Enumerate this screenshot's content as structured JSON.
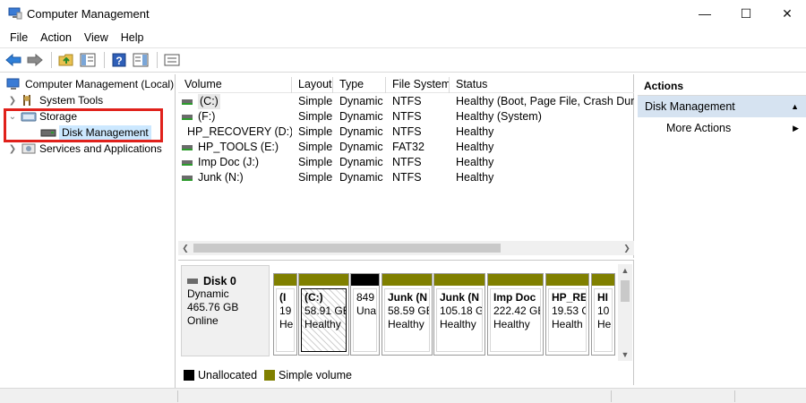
{
  "window": {
    "title": "Computer Management",
    "min_glyph": "—",
    "max_glyph": "☐",
    "close_glyph": "✕"
  },
  "menu": [
    "File",
    "Action",
    "View",
    "Help"
  ],
  "toolbar": {
    "icons": [
      "back-arrow-icon",
      "forward-arrow-icon",
      "up-folder-icon",
      "show-hide-console-tree-icon",
      "help-icon",
      "show-hide-action-pane-icon",
      "properties-icon"
    ]
  },
  "tree": {
    "root": "Computer Management (Local)",
    "items": [
      {
        "label": "System Tools"
      },
      {
        "label": "Storage"
      },
      {
        "label": "Disk Management"
      },
      {
        "label": "Services and Applications"
      }
    ]
  },
  "volumes": {
    "columns": [
      "Volume",
      "Layout",
      "Type",
      "File System",
      "Status"
    ],
    "rows": [
      {
        "volume": "(C:)",
        "layout": "Simple",
        "type": "Dynamic",
        "fs": "NTFS",
        "status": "Healthy (Boot, Page File, Crash Dump"
      },
      {
        "volume": "(F:)",
        "layout": "Simple",
        "type": "Dynamic",
        "fs": "NTFS",
        "status": "Healthy (System)"
      },
      {
        "volume": "HP_RECOVERY (D:)",
        "layout": "Simple",
        "type": "Dynamic",
        "fs": "NTFS",
        "status": "Healthy"
      },
      {
        "volume": "HP_TOOLS (E:)",
        "layout": "Simple",
        "type": "Dynamic",
        "fs": "FAT32",
        "status": "Healthy"
      },
      {
        "volume": "Imp Doc (J:)",
        "layout": "Simple",
        "type": "Dynamic",
        "fs": "NTFS",
        "status": "Healthy"
      },
      {
        "volume": "Junk (N:)",
        "layout": "Simple",
        "type": "Dynamic",
        "fs": "NTFS",
        "status": "Healthy"
      }
    ]
  },
  "disk": {
    "name": "Disk 0",
    "type": "Dynamic",
    "size": "465.76 GB",
    "state": "Online",
    "partitions": [
      {
        "name": "(I",
        "size": "19",
        "status": "He",
        "kind": "simple"
      },
      {
        "name": "(C:)",
        "size": "58.91 GE",
        "status": "Healthy",
        "kind": "simple",
        "selected": true
      },
      {
        "name": "",
        "size": "849",
        "status": "Una",
        "kind": "unallocated"
      },
      {
        "name": "Junk (N",
        "size": "58.59 GE",
        "status": "Healthy",
        "kind": "simple"
      },
      {
        "name": "Junk (N",
        "size": "105.18 G",
        "status": "Healthy",
        "kind": "simple"
      },
      {
        "name": "Imp Doc",
        "size": "222.42 GE",
        "status": "Healthy",
        "kind": "simple"
      },
      {
        "name": "HP_RE",
        "size": "19.53 G",
        "status": "Health",
        "kind": "simple"
      },
      {
        "name": "HI",
        "size": "10",
        "status": "He",
        "kind": "simple"
      }
    ]
  },
  "legend": [
    {
      "label": "Unallocated",
      "color": "#000000"
    },
    {
      "label": "Simple volume",
      "color": "#808000"
    }
  ],
  "actions": {
    "header": "Actions",
    "section": "Disk Management",
    "items": [
      "More Actions"
    ]
  },
  "colors": {
    "selection": "#cce8ff",
    "highlight_box": "#e0211b",
    "simple_volume_band": "#808000",
    "unallocated_band": "#000000",
    "actions_section_bg": "#d6e3f1"
  }
}
